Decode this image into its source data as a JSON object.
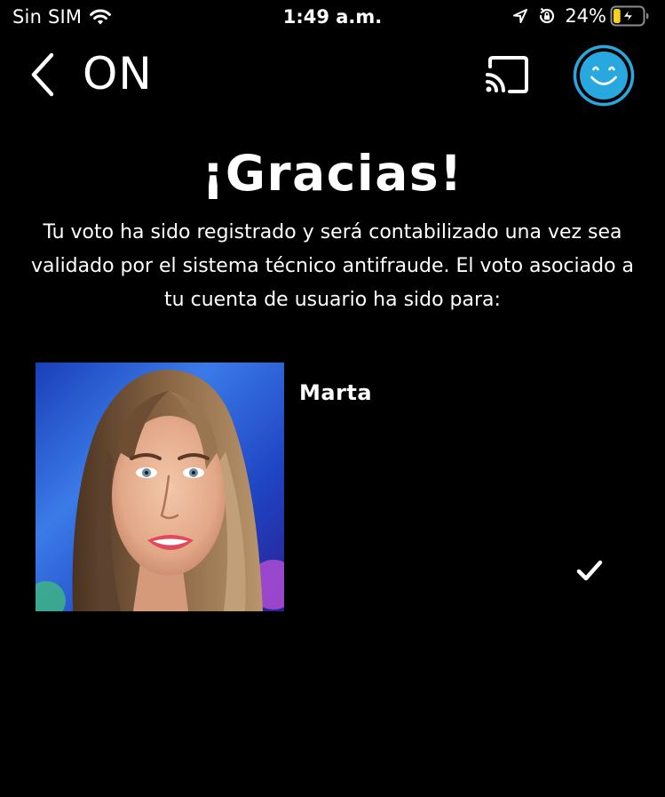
{
  "status_bar": {
    "carrier": "Sin SIM",
    "time": "1:49 a.m.",
    "battery_percent": "24%",
    "battery_level": 0.24,
    "icons": [
      "wifi-icon",
      "location-arrow-icon",
      "rotation-lock-icon",
      "battery-charging-icon"
    ]
  },
  "nav": {
    "logo": "ON",
    "icons": [
      "back-chevron-icon",
      "cast-icon",
      "smiley-profile-icon"
    ],
    "accent_color": "#29a8e0"
  },
  "confirmation": {
    "title": "¡Gracias!",
    "message": "Tu voto ha sido registrado y será contabilizado una vez sea validado por el sistema técnico antifraude. El voto asociado a tu cuenta de usuario ha sido para:"
  },
  "candidate": {
    "name": "Marta",
    "selected": true,
    "icons": [
      "checkmark-icon"
    ]
  }
}
